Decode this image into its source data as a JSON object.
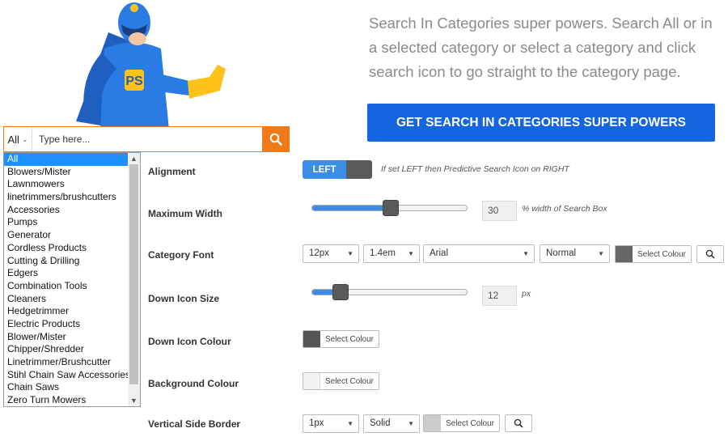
{
  "promo": {
    "text": "Search In Categories super powers. Search All or in a selected category or select a category and click search icon to go straight to the category page.",
    "button_label": "GET SEARCH IN CATEGORIES SUPER POWERS",
    "button_color": "#1565e0"
  },
  "search": {
    "category_selected": "All",
    "placeholder": "Type here...",
    "search_icon": "magnifier-icon",
    "accent_color": "#f07a1a",
    "categories": [
      "All",
      "Blowers/Mister",
      "Lawnmowers",
      "linetrimmers/brushcutters",
      "Accessories",
      "Pumps",
      "Generator",
      "Cordless Products",
      "Cutting & Drilling",
      "Edgers",
      "Combination Tools",
      "Cleaners",
      "Hedgetrimmer",
      "Electric Products",
      "Blower/Mister",
      "Chipper/Shredder",
      "Linetrimmer/Brushcutter",
      "Stihl Chain Saw Accessories",
      "Chain Saws",
      "Zero Turn Mowers"
    ]
  },
  "settings": {
    "alignment": {
      "label": "Alignment",
      "toggle_value": "LEFT",
      "hint": "If set LEFT then Predictive Search Icon on RIGHT"
    },
    "max_width": {
      "label": "Maximum Width",
      "value": "30",
      "unit_hint": "% width of Search Box",
      "slider_fraction": 0.5
    },
    "category_font": {
      "label": "Category Font",
      "size": "12px",
      "line_height": "1.4em",
      "family": "Arial",
      "weight": "Normal",
      "colour_label": "Select Colour",
      "swatch": "#666666"
    },
    "down_icon_size": {
      "label": "Down Icon Size",
      "value": "12",
      "unit_hint": "px",
      "slider_fraction": 0.18
    },
    "down_icon_colour": {
      "label": "Down Icon Colour",
      "colour_label": "Select Colour",
      "swatch": "#555555"
    },
    "background_colour": {
      "label": "Background Colour",
      "colour_label": "Select Colour",
      "swatch": "#f2f2f2"
    },
    "vertical_side_border": {
      "label": "Vertical Side Border",
      "width": "1px",
      "style": "Solid",
      "colour_label": "Select Colour",
      "swatch": "#cccccc"
    }
  }
}
